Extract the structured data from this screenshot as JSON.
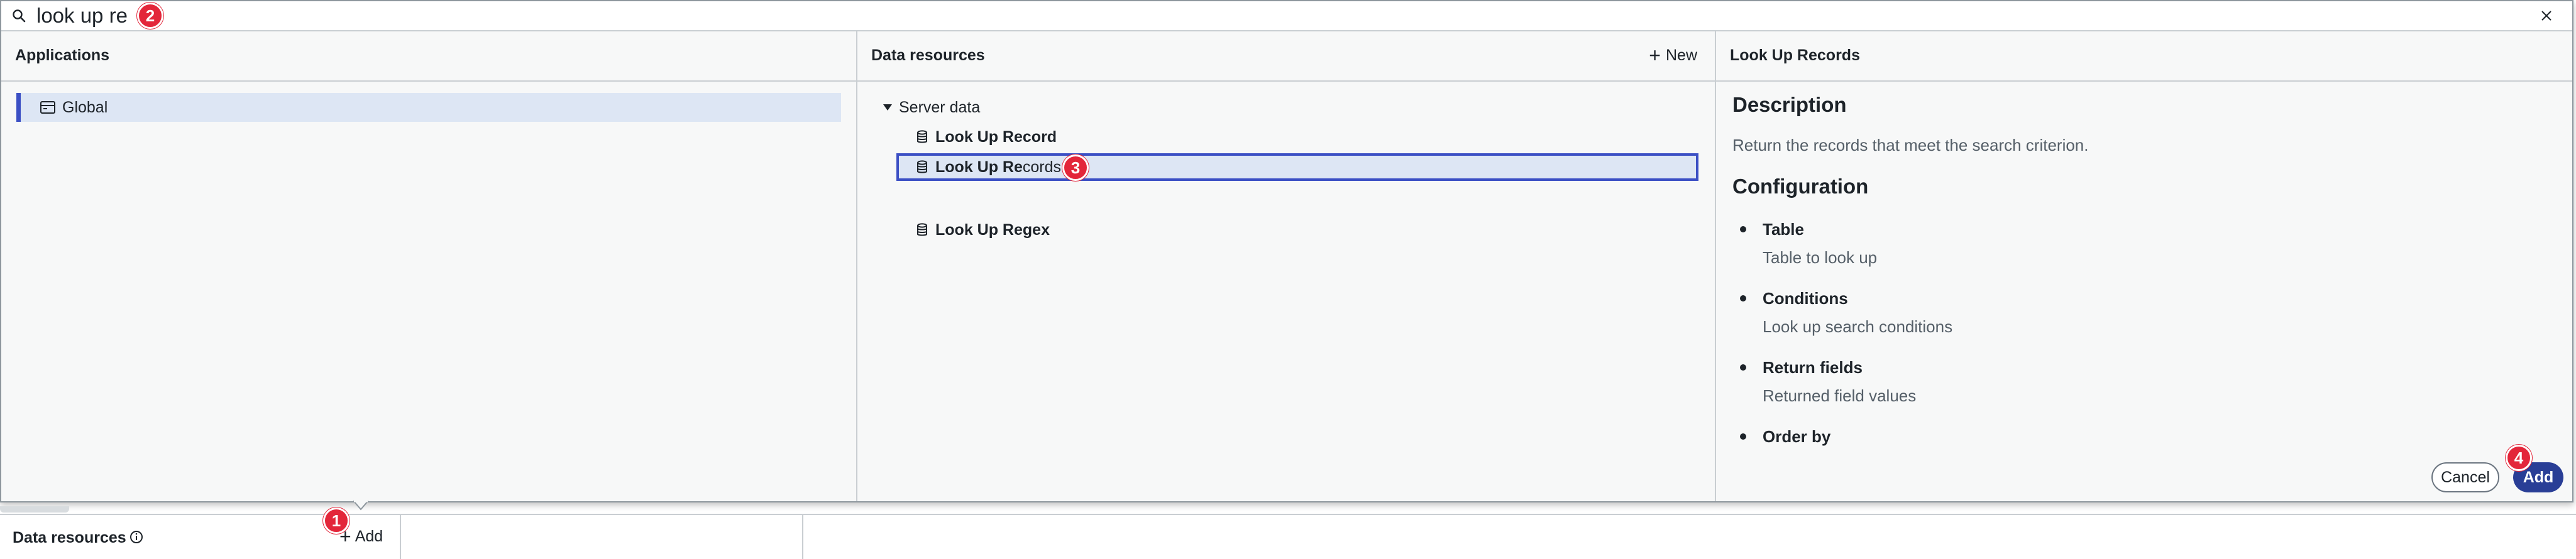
{
  "search": {
    "value": "look up re"
  },
  "panes": {
    "applications": {
      "title": "Applications",
      "items": [
        {
          "label": "Global",
          "icon": "application-icon"
        }
      ]
    },
    "data_resources": {
      "title": "Data resources",
      "new_label": "New",
      "group": {
        "label": "Server data",
        "icon": "caret-down-icon"
      },
      "items": [
        {
          "match": "Look Up Re",
          "rest": "cord",
          "icon": "database-icon",
          "selected": false
        },
        {
          "match": "Look Up Re",
          "rest": "cords",
          "icon": "database-icon",
          "selected": true
        },
        {
          "match": "Look Up Re",
          "rest": "gex",
          "icon": "database-icon",
          "selected": false
        }
      ]
    },
    "detail": {
      "title": "Look Up Records",
      "description_heading": "Description",
      "description": "Return the records that meet the search criterion.",
      "configuration_heading": "Configuration",
      "config": [
        {
          "name": "Table",
          "desc": "Table to look up"
        },
        {
          "name": "Conditions",
          "desc": "Look up search conditions"
        },
        {
          "name": "Return fields",
          "desc": "Returned field values"
        },
        {
          "name": "Order by",
          "desc": ""
        }
      ]
    }
  },
  "actions": {
    "cancel_label": "Cancel",
    "add_label": "Add"
  },
  "bottom_bar": {
    "title": "Data resources",
    "add_label": "Add"
  },
  "badges": [
    "1",
    "2",
    "3",
    "4"
  ],
  "colors": {
    "accent": "#3b4fc4",
    "selected_bg": "#dde6f4",
    "primary_button": "#293e96",
    "badge": "#e3263a"
  }
}
